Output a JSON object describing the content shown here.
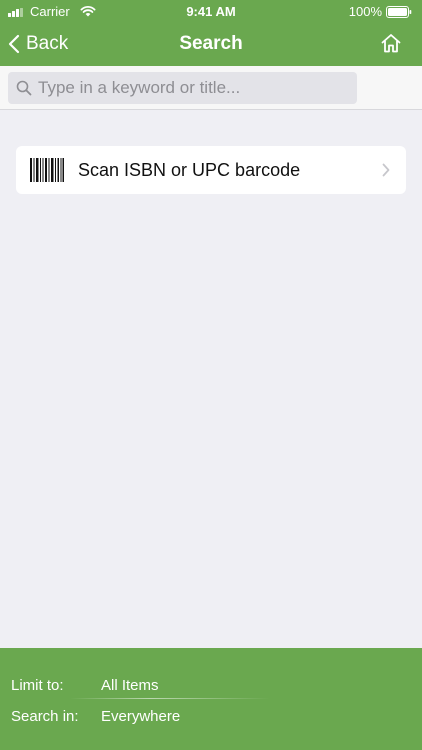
{
  "status_bar": {
    "carrier": "Carrier",
    "time": "9:41 AM",
    "battery": "100%"
  },
  "nav": {
    "back_label": "Back",
    "title": "Search",
    "home_icon": "home-icon"
  },
  "search": {
    "placeholder": "Type in a keyword or title...",
    "value": ""
  },
  "scan": {
    "label": "Scan ISBN or UPC barcode",
    "icon": "barcode-icon"
  },
  "footer": {
    "limit_label": "Limit to:",
    "limit_value": "All Items",
    "search_in_label": "Search in:",
    "search_in_value": "Everywhere"
  },
  "colors": {
    "brand": "#6aa84f",
    "background": "#efeff4"
  }
}
